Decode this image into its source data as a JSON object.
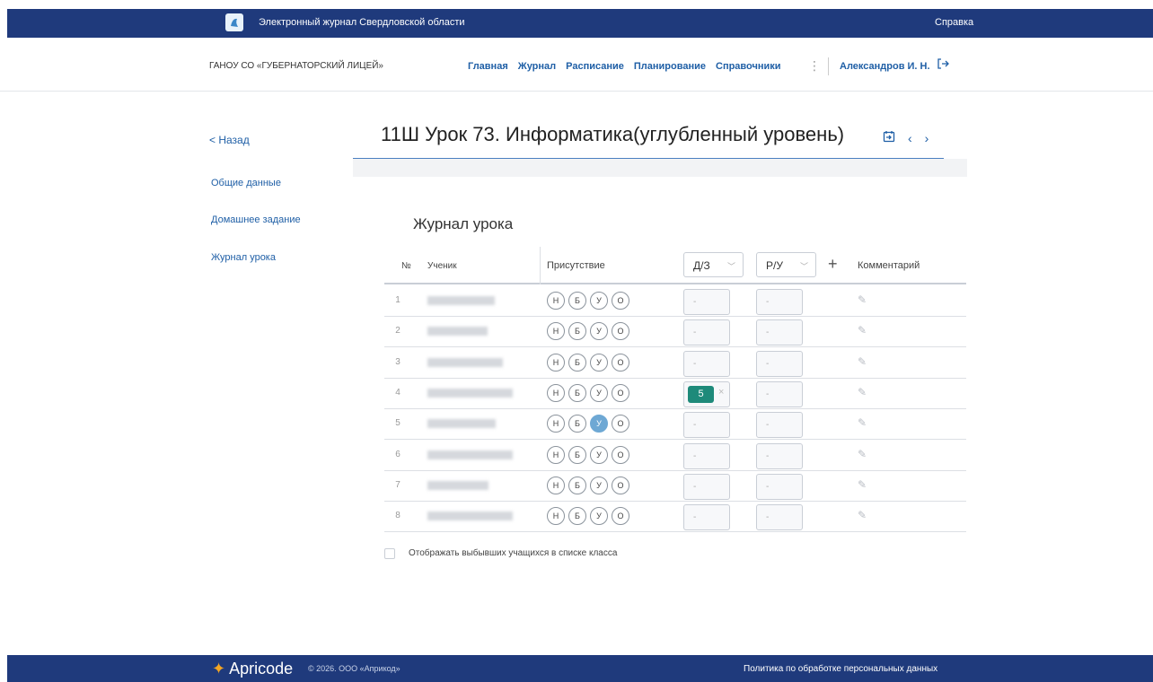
{
  "topbar": {
    "title": "Электронный журнал Свердловской области",
    "help": "Справка"
  },
  "nav": {
    "org": "ГАНОУ СО «ГУБЕРНАТОРСКИЙ ЛИЦЕЙ»",
    "links": [
      "Главная",
      "Журнал",
      "Расписание",
      "Планирование",
      "Справочники"
    ],
    "more": "⋮",
    "user": "Александров И. Н."
  },
  "page": {
    "back": "< Назад",
    "title": "11Ш Урок 73. Информатика(углубленный уровень)",
    "section_title": "Журнал урока"
  },
  "sidebar": {
    "items": [
      {
        "label": "Общие данные"
      },
      {
        "label": "Домашнее задание"
      },
      {
        "label": "Журнал урока"
      }
    ]
  },
  "table": {
    "headers": {
      "num": "№",
      "student": "Ученик",
      "attendance": "Присутствие",
      "hw": "Д/З",
      "cw": "Р/У",
      "add": "+",
      "comment": "Комментарий"
    },
    "attendance_options": [
      "Н",
      "Б",
      "У",
      "О"
    ],
    "empty_mark": "-",
    "rows": [
      {
        "num": "1",
        "attendance": "",
        "hw": "-",
        "cw": "-"
      },
      {
        "num": "2",
        "attendance": "",
        "hw": "-",
        "cw": "-"
      },
      {
        "num": "3",
        "attendance": "",
        "hw": "-",
        "cw": "-"
      },
      {
        "num": "4",
        "attendance": "",
        "hw": "5",
        "cw": "-"
      },
      {
        "num": "5",
        "attendance": "У",
        "hw": "-",
        "cw": "-"
      },
      {
        "num": "6",
        "attendance": "",
        "hw": "-",
        "cw": "-"
      },
      {
        "num": "7",
        "attendance": "",
        "hw": "-",
        "cw": "-"
      },
      {
        "num": "8",
        "attendance": "",
        "hw": "-",
        "cw": "-"
      }
    ]
  },
  "checkbox": {
    "label": "Отображать выбывших учащихся в списке класса",
    "checked": false
  },
  "footer": {
    "brand": "Apricode",
    "copyright": "© 2026. ООО «Априкод»",
    "policy": "Политика по обработке персональных данных"
  },
  "colors": {
    "header_bg": "#1f3a7c",
    "link": "#1f5fa6",
    "grade_bg": "#1e8a7a",
    "attendance_selected": "#6ea8d4"
  }
}
